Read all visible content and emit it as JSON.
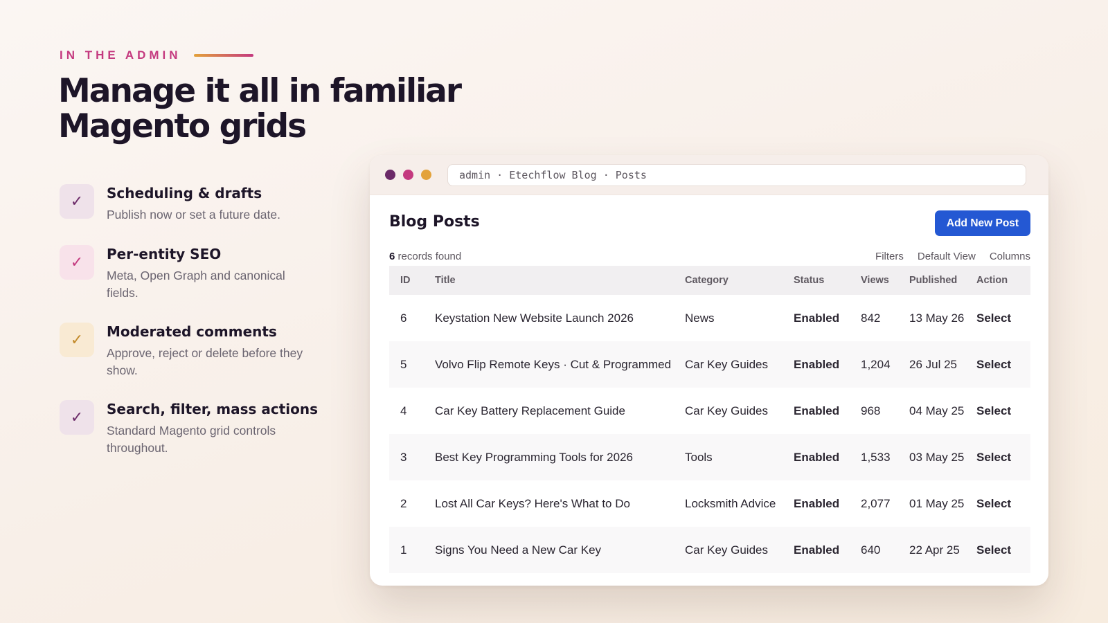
{
  "hero": {
    "eyebrow": "IN THE ADMIN",
    "headline_line1": "Manage it all in familiar",
    "headline_line2": "Magento grids"
  },
  "features": [
    {
      "title": "Scheduling & drafts",
      "desc": "Publish now or set a future date.",
      "icon": "check-icon",
      "color": "#6b2a68"
    },
    {
      "title": "Per-entity SEO",
      "desc": "Meta, Open Graph and canonical fields.",
      "icon": "check-icon",
      "color": "#c4397f"
    },
    {
      "title": "Moderated comments",
      "desc": "Approve, reject or delete before they show.",
      "icon": "check-icon",
      "color": "#c28a2a"
    },
    {
      "title": "Search, filter, mass actions",
      "desc": "Standard Magento grid controls throughout.",
      "icon": "check-icon",
      "color": "#6b2a68"
    }
  ],
  "window": {
    "dots": [
      "#6b2a68",
      "#c4397f",
      "#e3a23a"
    ],
    "address": "admin · Etechflow Blog · Posts"
  },
  "grid": {
    "title": "Blog Posts",
    "add_button": "Add New Post",
    "records_count": "6",
    "records_label": "records found",
    "toolbar": [
      "Filters",
      "Default View",
      "Columns"
    ],
    "columns": [
      "ID",
      "Title",
      "Category",
      "Status",
      "Views",
      "Published",
      "Action"
    ],
    "rows": [
      {
        "id": "6",
        "title": "Keystation New Website Launch 2026",
        "category": "News",
        "status": "Enabled",
        "views": "842",
        "published": "13 May 26",
        "action": "Select"
      },
      {
        "id": "5",
        "title": "Volvo Flip Remote Keys · Cut & Programmed",
        "category": "Car Key Guides",
        "status": "Enabled",
        "views": "1,204",
        "published": "26 Jul 25",
        "action": "Select"
      },
      {
        "id": "4",
        "title": "Car Key Battery Replacement Guide",
        "category": "Car Key Guides",
        "status": "Enabled",
        "views": "968",
        "published": "04 May 25",
        "action": "Select"
      },
      {
        "id": "3",
        "title": "Best Key Programming Tools for 2026",
        "category": "Tools",
        "status": "Enabled",
        "views": "1,533",
        "published": "03 May 25",
        "action": "Select"
      },
      {
        "id": "2",
        "title": "Lost All Car Keys? Here's What to Do",
        "category": "Locksmith Advice",
        "status": "Enabled",
        "views": "2,077",
        "published": "01 May 25",
        "action": "Select"
      },
      {
        "id": "1",
        "title": "Signs You Need a New Car Key",
        "category": "Car Key Guides",
        "status": "Enabled",
        "views": "640",
        "published": "22 Apr 25",
        "action": "Select"
      }
    ]
  }
}
